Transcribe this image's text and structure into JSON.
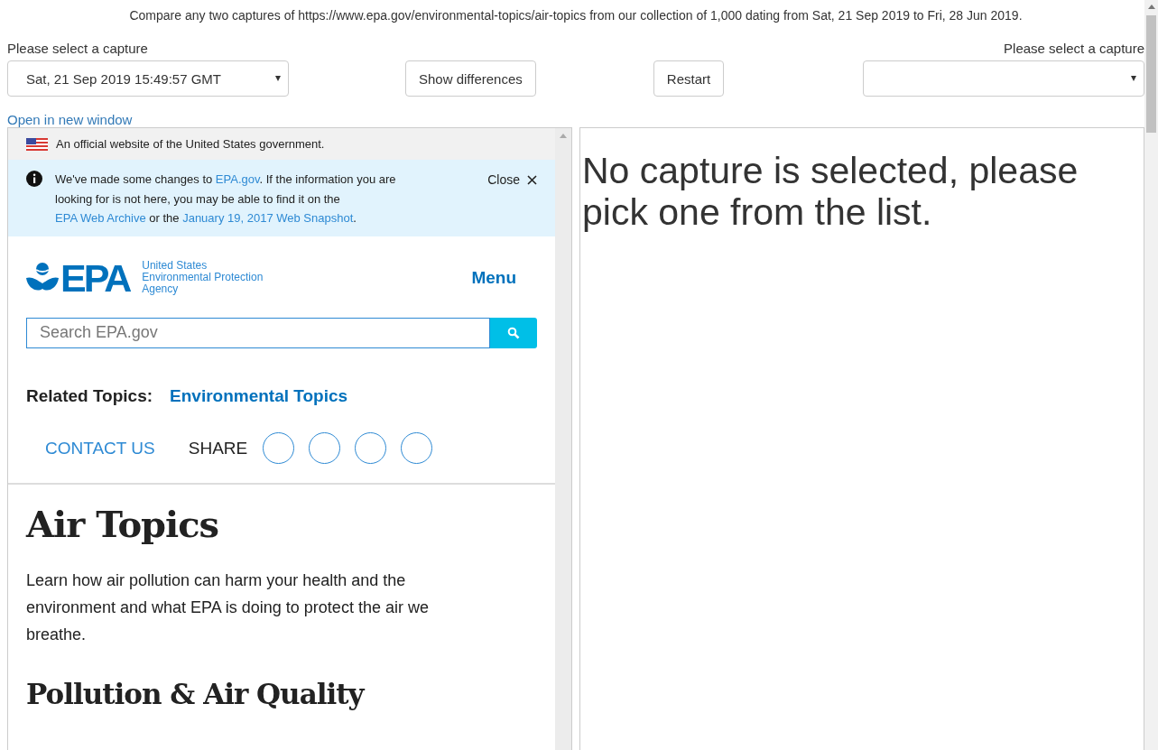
{
  "intro": "Compare any two captures of https://www.epa.gov/environmental-topics/air-topics from our collection of 1,000 dating from Sat, 21 Sep 2019 to Fri, 28 Jun 2019.",
  "left_label": "Please select a capture",
  "right_label": "Please select a capture",
  "left_select": {
    "value": "Sat, 21 Sep 2019 15:49:57 GMT"
  },
  "buttons": [
    "Show differences",
    "Restart"
  ],
  "open_link": "Open in new window",
  "capture": {
    "gov_banner": "An official website of the United States government.",
    "notice": [
      {
        "text": "We've made some changes to ",
        "link": false
      },
      {
        "text": "EPA.gov",
        "link": true
      },
      {
        "text": ". If the information you are looking for is not here, you may be able to find it on the ",
        "link": false
      },
      {
        "text": "EPA Web Archive",
        "link": true
      },
      {
        "text": " or the ",
        "link": false
      },
      {
        "text": "January 19, 2017 Web Snapshot",
        "link": true
      },
      {
        "text": ".",
        "link": false
      }
    ],
    "notice_close": "Close",
    "logo_text": "EPA",
    "agency": [
      "United States",
      "Environmental Protection",
      "Agency"
    ],
    "menu": "Menu",
    "search": {
      "placeholder": "Search EPA.gov"
    },
    "related_label": "Related Topics:",
    "related_link": "Environmental Topics",
    "contact": "CONTACT US",
    "share": "SHARE",
    "heading": "Air Topics",
    "intro": "Learn how air pollution can harm your health and the environment and what EPA is doing to protect the air we breathe.",
    "subheading": "Pollution & Air Quality"
  },
  "right_message": "No capture is selected, please pick one from the list."
}
